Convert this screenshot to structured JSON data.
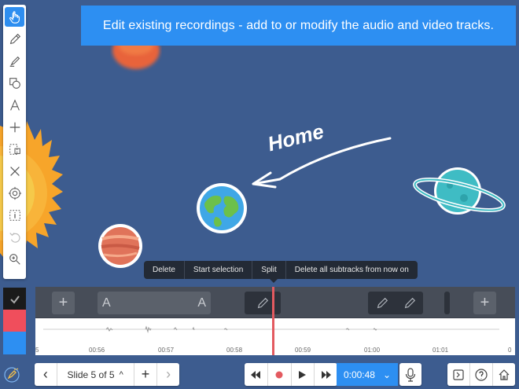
{
  "banner": {
    "text": "Edit existing recordings - add to or modify the audio and video tracks."
  },
  "canvas": {
    "annotation": "Home"
  },
  "toolbar": {
    "tools": [
      {
        "icon": "hand-pointer-icon",
        "active": true
      },
      {
        "icon": "pencil-icon"
      },
      {
        "icon": "highlighter-icon"
      },
      {
        "icon": "shapes-icon"
      },
      {
        "icon": "text-icon"
      },
      {
        "icon": "add-icon"
      },
      {
        "icon": "selection-icon"
      },
      {
        "icon": "delete-x-icon"
      },
      {
        "icon": "laser-pointer-icon"
      },
      {
        "icon": "info-box-icon"
      },
      {
        "icon": "undo-icon"
      },
      {
        "icon": "zoom-icon"
      }
    ]
  },
  "colors": {
    "black": "#1a1a1a",
    "red": "#f04e5c",
    "blue": "#2d8ff2",
    "accent": "#2d8ff2"
  },
  "context_menu": {
    "delete": "Delete",
    "start_selection": "Start selection",
    "split": "Split",
    "delete_all": "Delete all subtracks from now on"
  },
  "timeline": {
    "text_tool_left": "A",
    "text_tool_right": "A",
    "ticks": [
      "5",
      "00:56",
      "00:57",
      "00:58",
      "00:59",
      "01:00",
      "01:01",
      "0"
    ]
  },
  "bottom": {
    "prev": "‹",
    "slide_label": "Slide 5 of 5",
    "caret_up": "^",
    "add": "+",
    "next": "›",
    "time": "0:00:48",
    "caret_down": "⌄"
  }
}
